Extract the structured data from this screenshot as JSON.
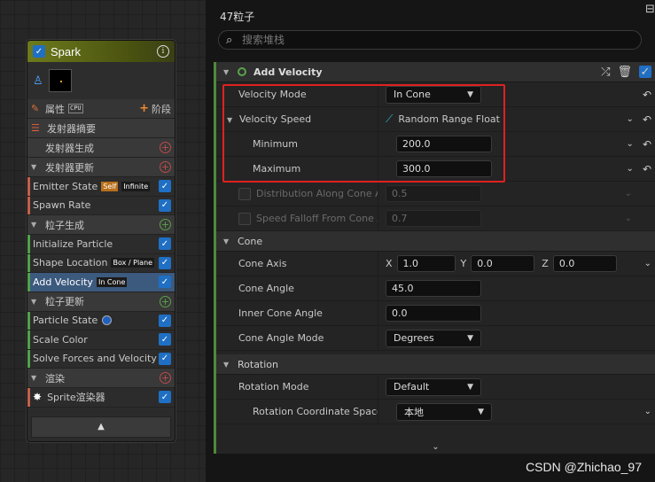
{
  "node": {
    "title": "Spark",
    "properties_label": "属性",
    "cpu_label": "CPU",
    "stage_label": "阶段",
    "summary_label": "发射器摘要",
    "emitter_spawn_label": "发射器生成",
    "emitter_update_label": "发射器更新",
    "emitter_update_modules": [
      {
        "label": "Emitter State",
        "badges": [
          "Self",
          "Infinite"
        ]
      },
      {
        "label": "Spawn Rate",
        "badges": []
      }
    ],
    "particle_spawn_label": "粒子生成",
    "particle_spawn_modules": [
      {
        "label": "Initialize Particle",
        "badge": ""
      },
      {
        "label": "Shape Location",
        "badge": "Box / Plane"
      },
      {
        "label": "Add Velocity",
        "badge": "In Cone"
      }
    ],
    "particle_update_label": "粒子更新",
    "particle_update_modules": [
      {
        "label": "Particle State"
      },
      {
        "label": "Scale Color"
      },
      {
        "label": "Solve Forces and Velocity"
      }
    ],
    "render_label": "渲染",
    "render_modules": [
      {
        "label": "Sprite渲染器"
      }
    ]
  },
  "panel": {
    "header_title": "Spark",
    "particle_count": "47粒子",
    "search_placeholder": "搜索堆栈"
  },
  "add_velocity": {
    "title": "Add Velocity",
    "velocity_mode": {
      "label": "Velocity Mode",
      "value": "In Cone"
    },
    "velocity_speed": {
      "label": "Velocity Speed",
      "value": "Random Range Float"
    },
    "minimum": {
      "label": "Minimum",
      "value": "200.0"
    },
    "maximum": {
      "label": "Maximum",
      "value": "300.0"
    },
    "distribution": {
      "label": "Distribution Along Cone Ax",
      "value": "0.5"
    },
    "speed_falloff": {
      "label": "Speed Falloff From Cone A",
      "value": "0.7"
    }
  },
  "cone": {
    "title": "Cone",
    "axis": {
      "label": "Cone Axis",
      "x_label": "X",
      "x": "1.0",
      "y_label": "Y",
      "y": "0.0",
      "z_label": "Z",
      "z": "0.0"
    },
    "angle": {
      "label": "Cone Angle",
      "value": "45.0"
    },
    "inner_angle": {
      "label": "Inner Cone Angle",
      "value": "0.0"
    },
    "angle_mode": {
      "label": "Cone Angle Mode",
      "value": "Degrees"
    }
  },
  "rotation": {
    "title": "Rotation",
    "mode": {
      "label": "Rotation Mode",
      "value": "Default"
    },
    "coord_space": {
      "label": "Rotation Coordinate Space",
      "value": "本地"
    }
  },
  "watermark": "CSDN @Zhichao_97",
  "colors": {
    "accent_blue": "#1f6fc4",
    "highlight_red": "#e02020",
    "module_green": "#5ba24a",
    "header_olive": "#6e7a1c"
  }
}
